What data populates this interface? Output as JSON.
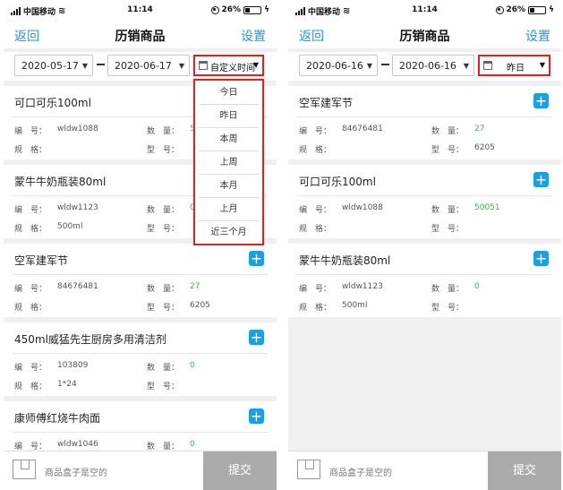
{
  "status": {
    "carrier": "中国移动",
    "time": "11:14",
    "battery": "26%",
    "battery_level": 0.26
  },
  "nav": {
    "back": "返回",
    "title": "历销商品",
    "settings": "设置"
  },
  "labels": {
    "code": "编　号：",
    "spec": "规　格：",
    "qty": "数　量：",
    "model": "型　号："
  },
  "icons": {
    "add": "+",
    "caret": "▼"
  },
  "footer": {
    "empty": "商品盒子是空的",
    "submit": "提交"
  },
  "left": {
    "start_date": "2020-05-17",
    "end_date": "2020-06-17",
    "range_label": "自定义时间",
    "dropdown": [
      "今日",
      "昨日",
      "本周",
      "上周",
      "本月",
      "上月",
      "近三个月"
    ],
    "items": [
      {
        "name": "可口可乐100ml",
        "code": "wldw1088",
        "qty": "5",
        "spec": "",
        "model": ""
      },
      {
        "name": "蒙牛牛奶瓶装80ml",
        "code": "wldw1123",
        "qty": "0",
        "spec": "500ml",
        "model": ""
      },
      {
        "name": "空军建军节",
        "code": "84676481",
        "qty": "27",
        "spec": "",
        "model": "6205"
      },
      {
        "name": "450ml威猛先生厨房多用清洁剂",
        "code": "103809",
        "qty": "0",
        "spec": "1*24",
        "model": ""
      },
      {
        "name": "康师傅红烧牛肉面",
        "code": "wldw1046",
        "qty": "0",
        "spec": "",
        "model": ""
      }
    ]
  },
  "right": {
    "start_date": "2020-06-16",
    "end_date": "2020-06-16",
    "range_label": "昨日",
    "items": [
      {
        "name": "空军建军节",
        "code": "84676481",
        "qty": "27",
        "spec": "",
        "model": "6205"
      },
      {
        "name": "可口可乐100ml",
        "code": "wldw1088",
        "qty": "50051",
        "spec": "",
        "model": ""
      },
      {
        "name": "蒙牛牛奶瓶装80ml",
        "code": "wldw1123",
        "qty": "0",
        "spec": "500ml",
        "model": ""
      }
    ]
  }
}
